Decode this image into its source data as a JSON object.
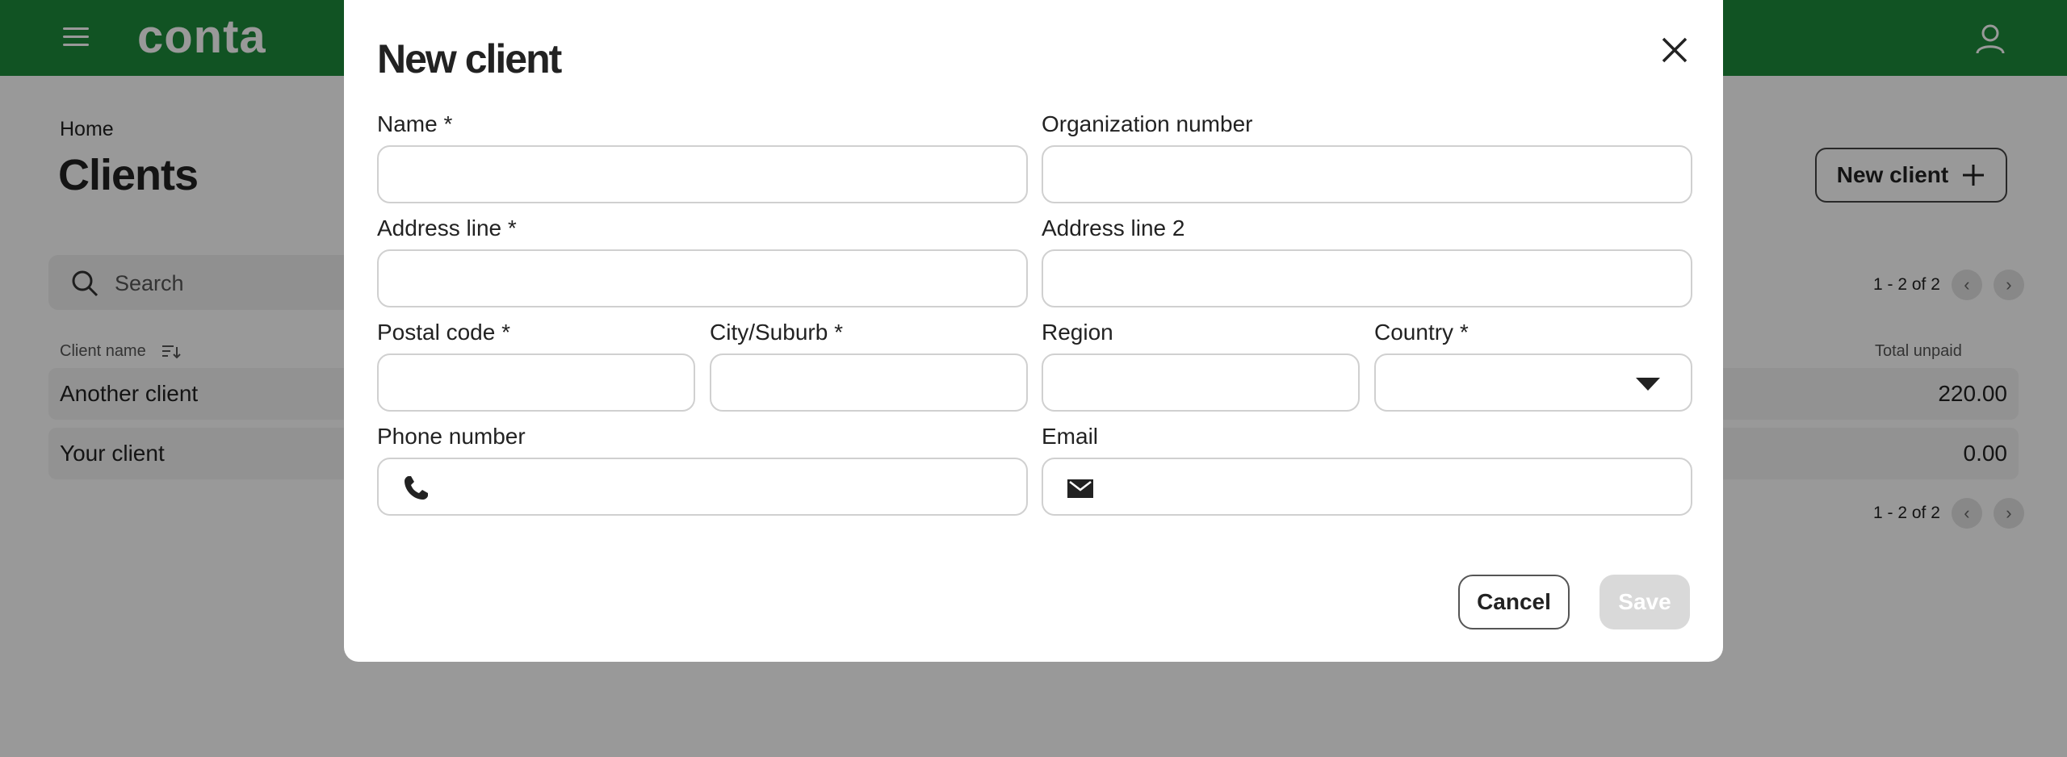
{
  "app": {
    "logo": "conta",
    "brand_color": "#1d8a3b"
  },
  "page": {
    "breadcrumb": "Home",
    "title": "Clients",
    "new_client_label": "New client",
    "search_placeholder": "Search",
    "pagination_text": "1 - 2 of 2"
  },
  "table": {
    "columns": [
      "Client name",
      "Total unpaid"
    ],
    "rows": [
      {
        "name": "Another client",
        "total_unpaid": "220.00"
      },
      {
        "name": "Your client",
        "total_unpaid": "0.00"
      }
    ]
  },
  "modal": {
    "title": "New client",
    "fields": {
      "name": {
        "label": "Name *",
        "value": ""
      },
      "org_number": {
        "label": "Organization number",
        "value": ""
      },
      "address_line": {
        "label": "Address line *",
        "value": ""
      },
      "address_line_2": {
        "label": "Address line 2",
        "value": ""
      },
      "postal_code": {
        "label": "Postal code *",
        "value": ""
      },
      "city": {
        "label": "City/Suburb *",
        "value": ""
      },
      "region": {
        "label": "Region",
        "value": ""
      },
      "country": {
        "label": "Country *",
        "value": ""
      },
      "phone": {
        "label": "Phone number",
        "value": ""
      },
      "email": {
        "label": "Email",
        "value": ""
      }
    },
    "cancel_label": "Cancel",
    "save_label": "Save"
  }
}
